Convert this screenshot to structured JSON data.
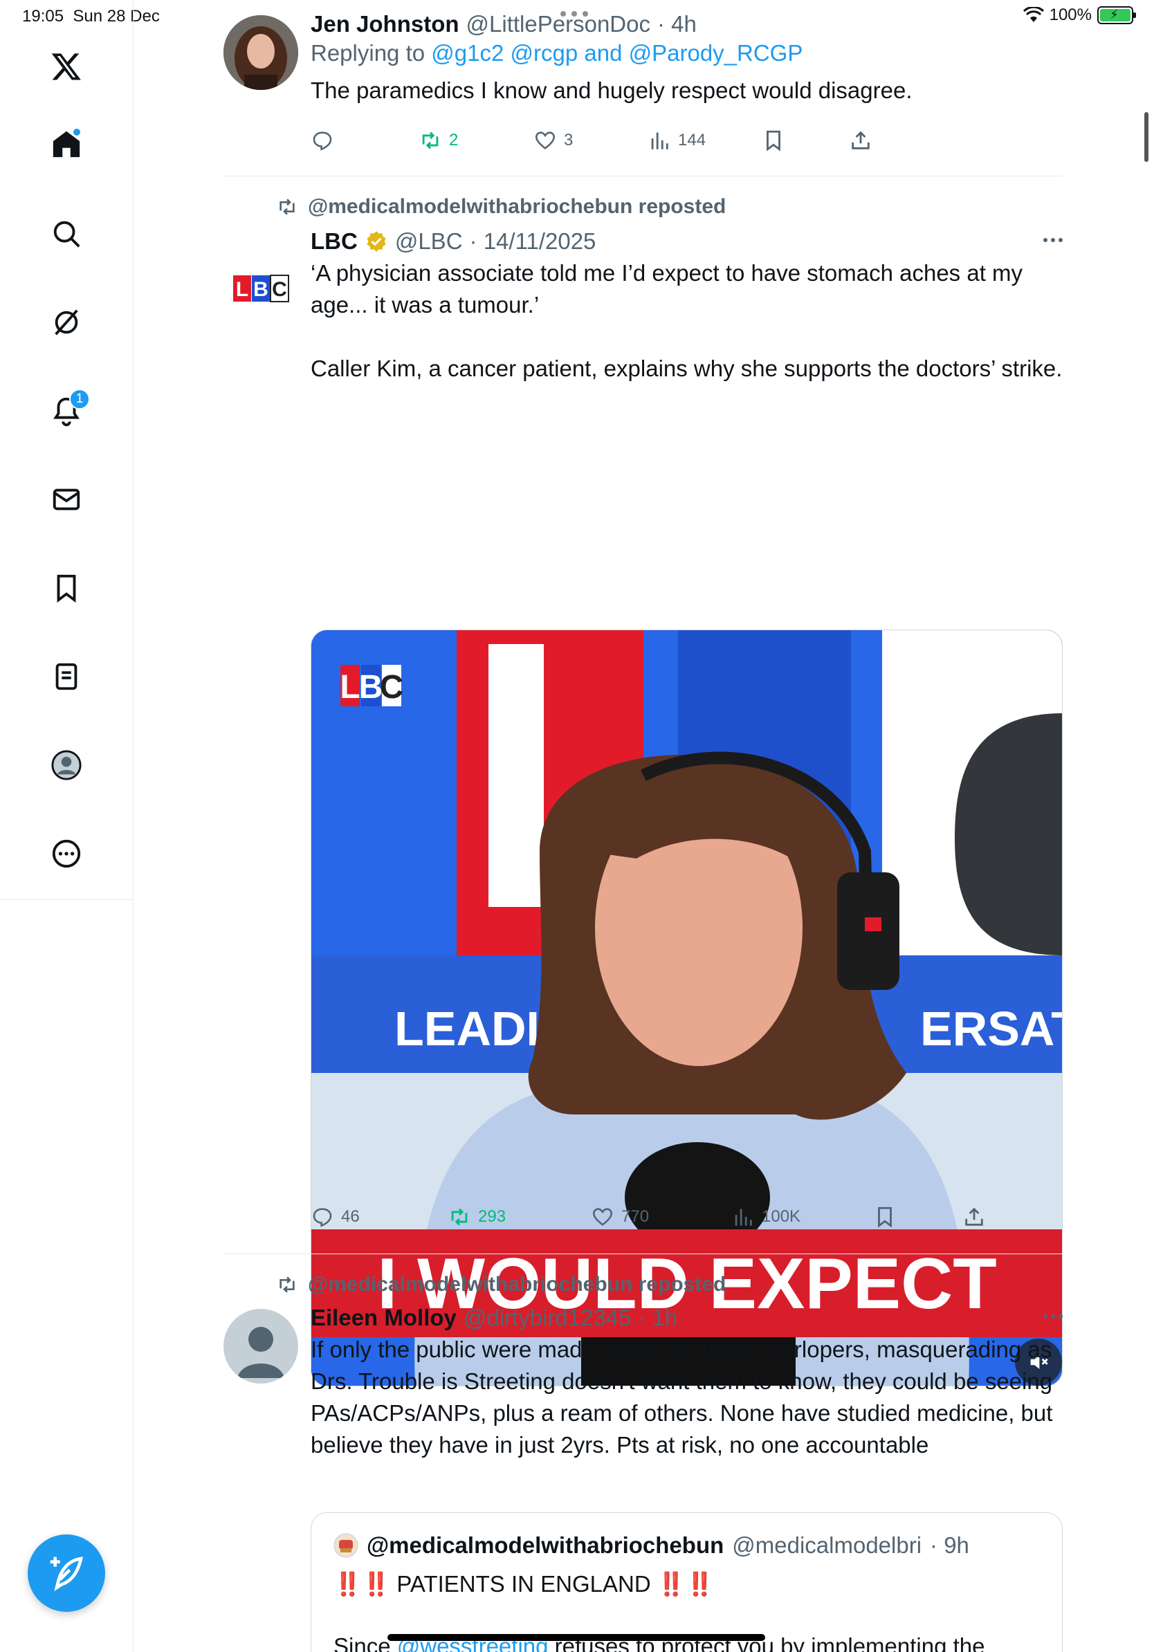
{
  "status_bar": {
    "time": "19:05",
    "date": "Sun 28 Dec",
    "battery": "100%"
  },
  "sidebar": {
    "items": [
      {
        "icon": "x-logo-icon"
      },
      {
        "icon": "home-icon",
        "has_dot": true
      },
      {
        "icon": "search-icon"
      },
      {
        "icon": "grok-icon"
      },
      {
        "icon": "notifications-icon",
        "badge": "1"
      },
      {
        "icon": "messages-icon"
      },
      {
        "icon": "bookmarks-icon"
      },
      {
        "icon": "lists-icon"
      },
      {
        "icon": "profile-icon"
      },
      {
        "icon": "more-icon"
      }
    ],
    "compose_icon": "compose-icon"
  },
  "posts": [
    {
      "name": "Jen Johnston",
      "handle": "@LittlePersonDoc",
      "time": "· 4h",
      "replying_prefix": "Replying to",
      "replying_to": "@g1c2 @rcgp",
      "replying_and": "and",
      "replying_last": "@Parody_RCGP",
      "text": "The paramedics I know and hugely respect would disagree.",
      "stats": {
        "replies": "",
        "reposts": "2",
        "likes": "3",
        "views": "144"
      }
    },
    {
      "repost_label": "@medicalmodelwithabriochebun reposted",
      "name": "LBC",
      "handle": "@LBC",
      "time": "· 14/11/2025",
      "text1": "‘A physician associate told me I’d expect to have stomach aches at my age... it was a tumour.’",
      "text2": "Caller Kim, a cancer patient, explains why she supports the doctors’ strike.",
      "video": {
        "logo": "LBC",
        "backdrop_left": "LEADIN",
        "backdrop_right": "ERSATI",
        "caption": "I WOULD EXPECT"
      },
      "stats": {
        "replies": "46",
        "reposts": "293",
        "likes": "770",
        "views": "100K"
      }
    },
    {
      "repost_label": "@medicalmodelwithabriochebun reposted",
      "name": "Eileen Molloy",
      "handle": "@dirtybird12345",
      "time": "· 1h",
      "text": "If only the public were made aware of these interlopers, masquerading as Drs. Trouble is Streeting doesn't want them to know, they could be seeing PAs/ACPs/ANPs, plus a ream of others. None have studied medicine, but believe they have in just 2yrs. Pts at risk, no one accountable",
      "quote": {
        "name": "@medicalmodelwithabriochebun",
        "handle": "@medicalmodelbri",
        "time": "· 9h",
        "line1": "‼️‼️ PATIENTS IN ENGLAND ‼️‼️",
        "line2_prefix": "Since",
        "line2_link": "@wesstreeting",
        "line2_rest": "refuses to protect you by implementing the"
      }
    }
  ],
  "colors": {
    "accent": "#1d9bf0",
    "repost_green": "#00ba7c",
    "secondary_text": "#536471",
    "lbc_red": "#e21b2b"
  }
}
